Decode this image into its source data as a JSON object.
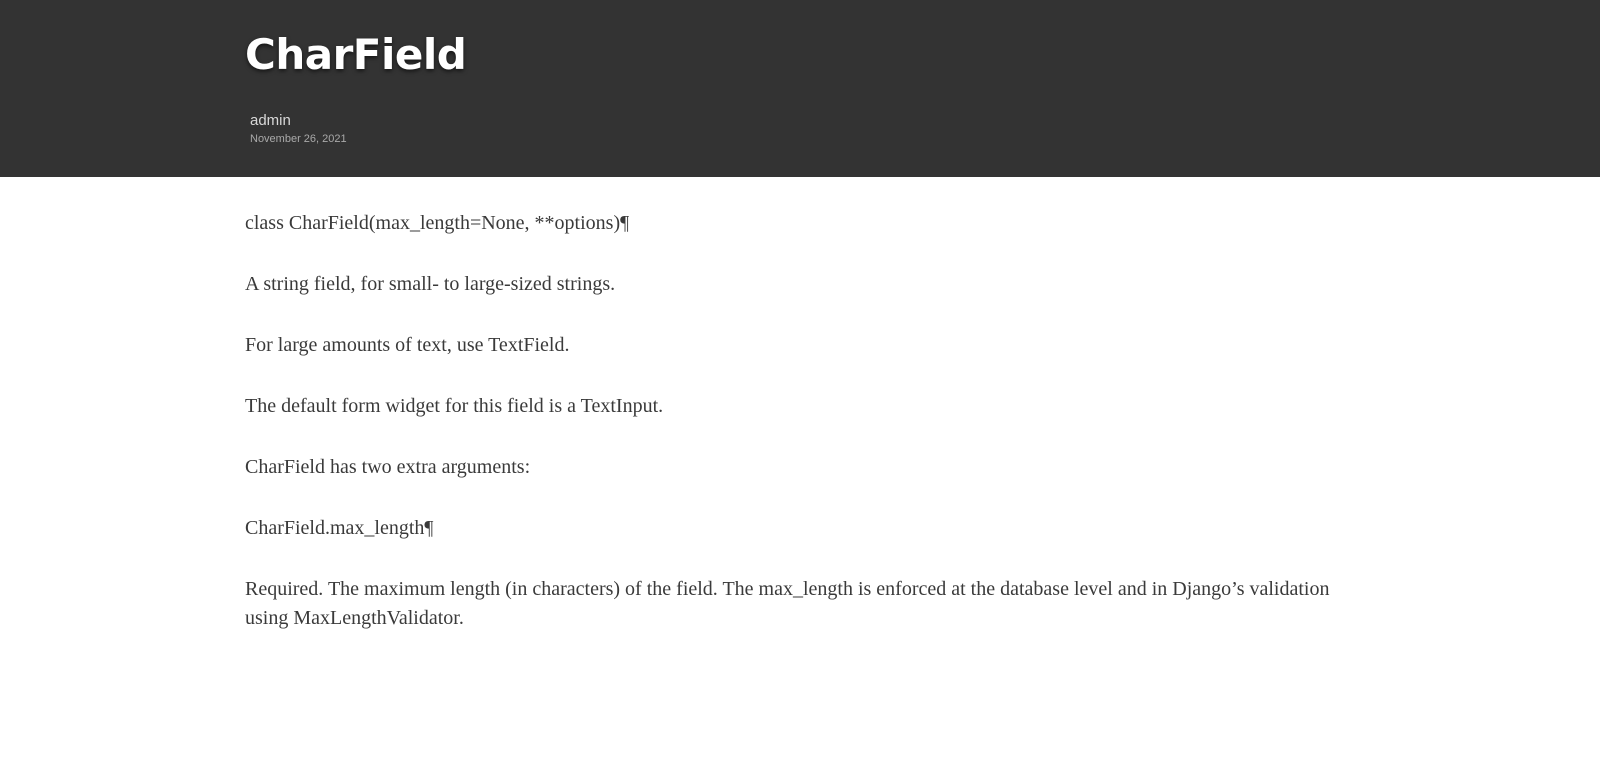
{
  "header": {
    "title": "CharField",
    "author": "admin",
    "date": "November 26, 2021"
  },
  "content": {
    "paragraphs": [
      "class CharField(max_length=None, **options)¶",
      "A string field, for small- to large-sized strings.",
      "For large amounts of text, use TextField.",
      "The default form widget for this field is a TextInput.",
      "CharField has two extra arguments:",
      "CharField.max_length¶",
      "Required. The maximum length (in characters) of the field. The max_length is enforced at the database level and in Django’s validation using MaxLengthValidator."
    ]
  },
  "colors": {
    "header_bg": "#333333",
    "title": "#ffffff",
    "body_text": "#3a3a3a"
  }
}
